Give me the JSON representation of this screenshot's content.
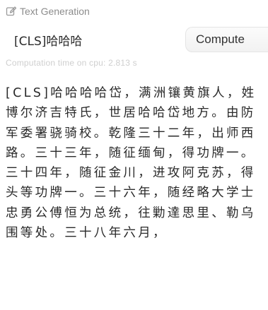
{
  "widget": {
    "title": "Text Generation",
    "title_icon": "pencil-square-icon"
  },
  "input": {
    "value": "[CLS]哈哈哈"
  },
  "compute_button": {
    "label": "Compute"
  },
  "computation_time": "Computation time on cpu: 2.813 s",
  "output_text": "[CLS]哈哈哈哈岱，满洲镶黄旗人，姓博尔济吉特氏，世居哈哈岱地方。由防军委署骁骑校。乾隆三十二年，出师西路。三十三年，随征缅甸，得功牌一。三十四年，随征金川，进攻阿克苏，得头等功牌一。三十六年，随经略大学士忠勇公傅恒为总统，往勦達思里、勒乌围等处。三十八年六月，"
}
